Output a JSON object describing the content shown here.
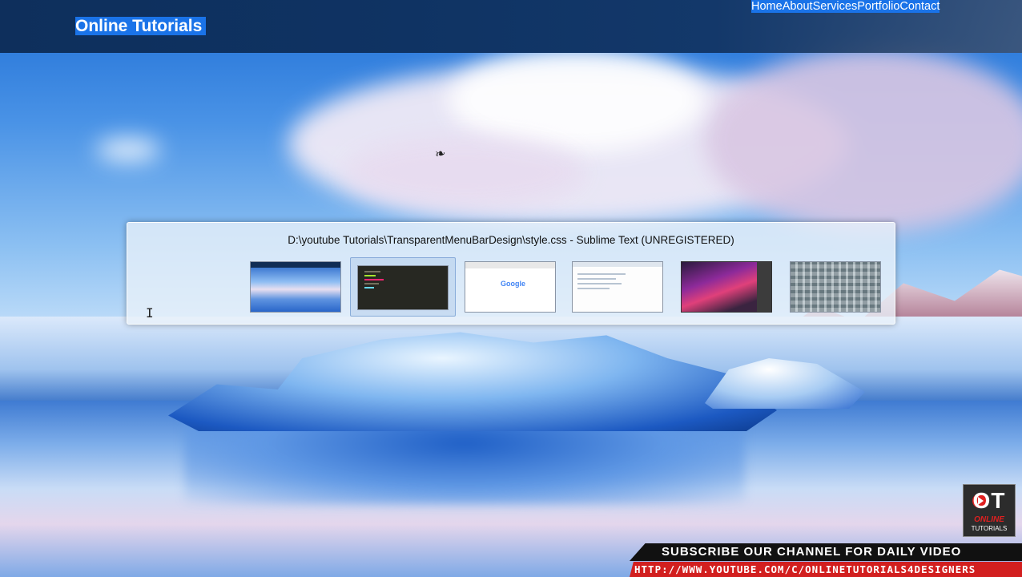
{
  "navbar": {
    "logo": "Online Tutorials",
    "menu": [
      "Home",
      "About",
      "Services",
      "Portfolio",
      "Contact"
    ],
    "highlight_color": "#1a73e8"
  },
  "task_switcher": {
    "title": "D:\\youtube Tutorials\\TransparentMenuBarDesign\\style.css - Sublime Text (UNREGISTERED)",
    "selected_index": 1,
    "thumbnail_google_text": "Google"
  },
  "watermark": {
    "logo_letters": "OT",
    "logo_line1": "ONLINE",
    "logo_line2": "TUTORIALS",
    "subscribe": "SUBSCRIBE OUR CHANNEL FOR DAILY VIDEO",
    "url": "HTTP://WWW.YOUTUBE.COM/C/ONLINETUTORIALS4DESIGNERS",
    "accent_color": "#d21f1f"
  },
  "icons": {
    "cursor": "text-cursor-icon",
    "bird": "bird-icon"
  }
}
